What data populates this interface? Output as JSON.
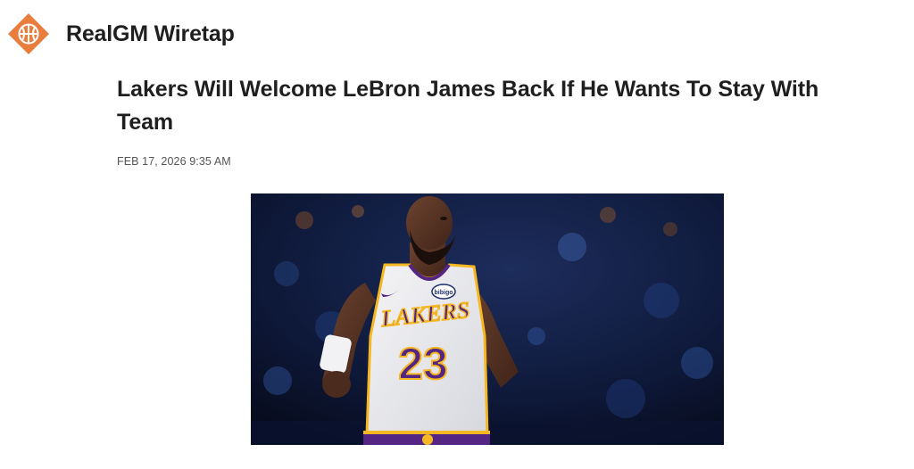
{
  "site": {
    "name": "RealGM Wiretap",
    "logo_icon": "basketball-logo-icon",
    "brand_color": "#e87d3e"
  },
  "article": {
    "title": "Lakers Will Welcome LeBron James Back If He Wants To Stay With Team",
    "timestamp": "FEB 17, 2026 9:35 AM",
    "image": {
      "description_icon": "player-photo",
      "jersey_text": "LAKERS",
      "jersey_number": "23",
      "patch_text": "bibigo"
    }
  }
}
